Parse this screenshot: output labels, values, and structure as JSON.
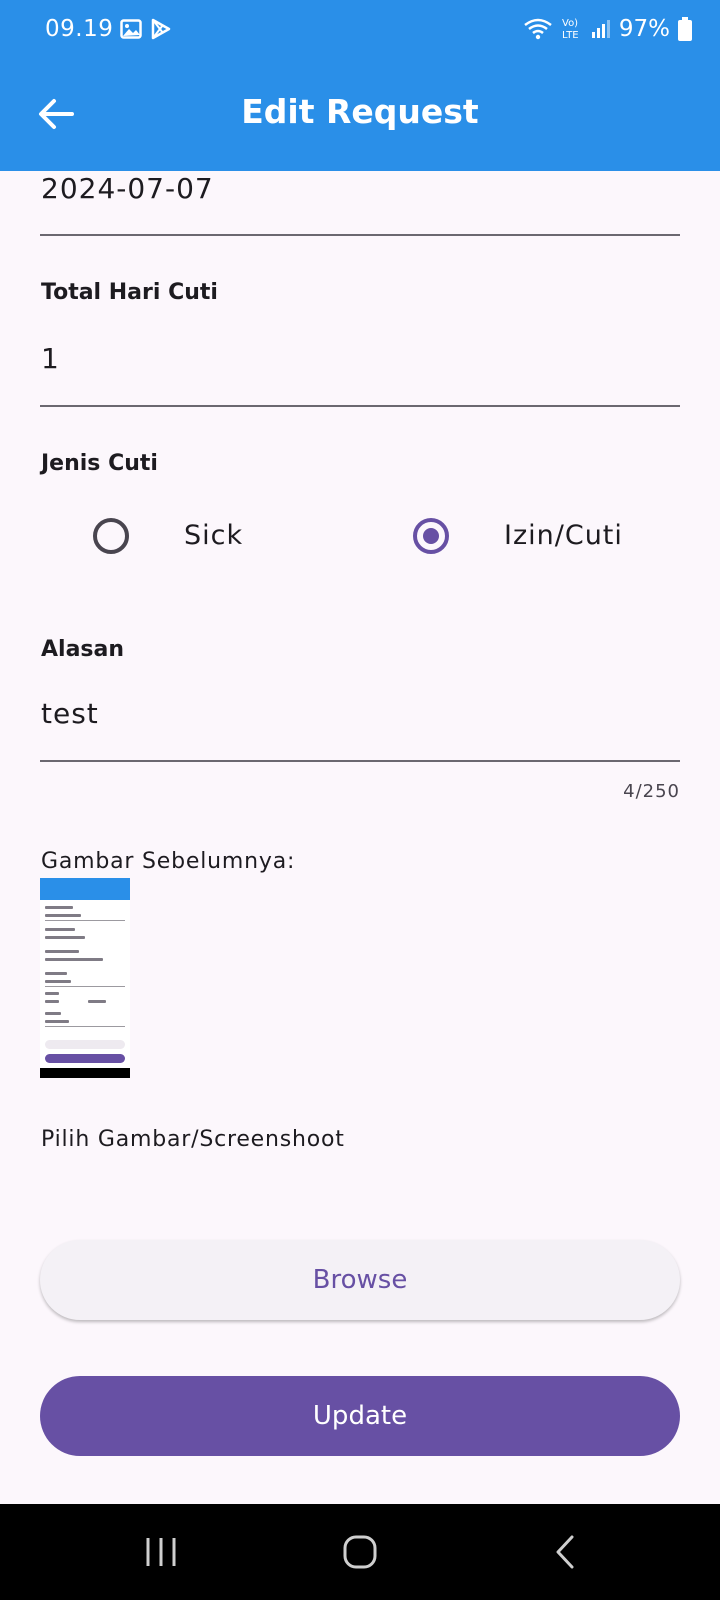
{
  "status_bar": {
    "time": "09.19",
    "battery": "97%",
    "icons": [
      "gallery-icon",
      "play-store-icon",
      "wifi-icon",
      "volte-icon",
      "signal-icon",
      "battery-icon"
    ]
  },
  "app_bar": {
    "title": "Edit Request",
    "back_icon": "arrow-back-icon",
    "background": "#2a8fe8"
  },
  "form": {
    "date_value": "2024-07-07",
    "total_days": {
      "label": "Total Hari Cuti",
      "value": "1"
    },
    "leave_type": {
      "label": "Jenis Cuti",
      "options": [
        {
          "label": "Sick",
          "selected": false
        },
        {
          "label": "Izin/Cuti",
          "selected": true
        }
      ]
    },
    "reason": {
      "label": "Alasan",
      "value": "test",
      "counter": "4/250"
    },
    "previous_image": {
      "label": "Gambar Sebelumnya:"
    },
    "pick_image": {
      "label": "Pilih Gambar/Screenshoot",
      "browse_label": "Browse"
    },
    "update_label": "Update"
  },
  "nav_bar": {
    "icons": [
      "recent-apps-icon",
      "home-icon",
      "back-icon"
    ]
  },
  "colors": {
    "primary": "#6750a4",
    "app_bar": "#2a8fe8",
    "background": "#fcf7fc"
  }
}
